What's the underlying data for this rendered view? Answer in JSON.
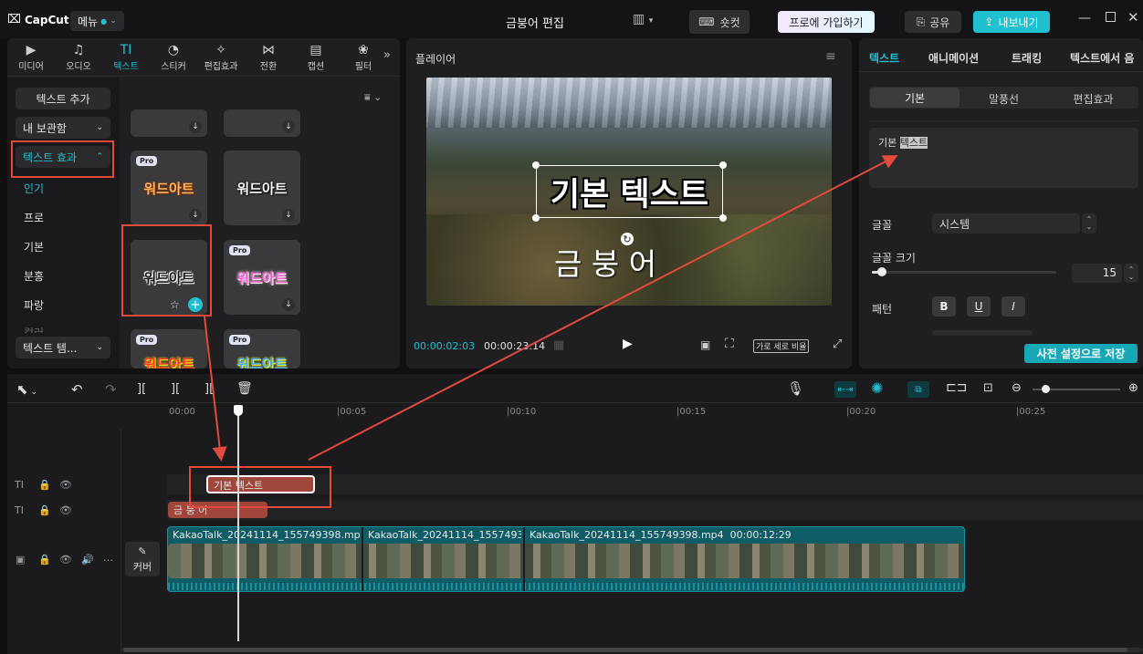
{
  "titlebar": {
    "logo": "CapCut",
    "menu": "메뉴",
    "project_title": "금붕어 편집",
    "shortcut": "숏컷",
    "pro_signup": "프로에 가입하기",
    "share": "공유",
    "export": "내보내기"
  },
  "media_tabs": [
    {
      "label": "미디어",
      "icon": "media-icon"
    },
    {
      "label": "오디오",
      "icon": "audio-icon"
    },
    {
      "label": "텍스트",
      "icon": "text-icon"
    },
    {
      "label": "스티커",
      "icon": "sticker-icon"
    },
    {
      "label": "편집효과",
      "icon": "effects-icon"
    },
    {
      "label": "전환",
      "icon": "transition-icon"
    },
    {
      "label": "캡션",
      "icon": "caption-icon"
    },
    {
      "label": "필터",
      "icon": "filter-icon"
    }
  ],
  "text_sidebar": {
    "add_text": "텍스트 추가",
    "my_collection": "내 보관함",
    "text_effects": "텍스트 효과",
    "items": [
      "인기",
      "프로",
      "기본",
      "분홍",
      "파랑",
      "컬러"
    ],
    "text_templates": "텍스트 템..."
  },
  "wordart": {
    "label": "워드아트",
    "pro_badge": "Pro"
  },
  "player": {
    "header": "플레이어",
    "current_time": "00:00:02:03",
    "total_time": "00:00:23:14",
    "ratio_label": "가로 세로 비율",
    "overlay_text_main": "기본 텍스트",
    "overlay_text_sub": "금 붕 어"
  },
  "inspector": {
    "tabs": [
      "텍스트",
      "애니메이션",
      "트래킹",
      "텍스트에서 음"
    ],
    "subtabs": [
      "기본",
      "말풍선",
      "편집효과"
    ],
    "text_value_plain": "기본 ",
    "text_value_selected": "텍스트",
    "font_label": "글꼴",
    "font_value": "시스템",
    "size_label": "글꼴 크기",
    "size_value": "15",
    "size_fraction": 0.05,
    "pattern_label": "패턴",
    "bold": "B",
    "underline": "U",
    "italic": "I",
    "save_preset": "사전 설정으로 저장"
  },
  "timeline": {
    "ruler": [
      "00:00",
      "|00:05",
      "|00:10",
      "|00:15",
      "|00:20",
      "|00:25"
    ],
    "text_clip_1": "기본 텍스트",
    "text_clip_2": "금 붕 어",
    "cover_label": "커버",
    "video_clips": [
      {
        "name": "KakaoTalk_20241114_155749398.mp4",
        "extra": "00"
      },
      {
        "name": "KakaoTalk_20241114_155749398.r",
        "extra": ""
      },
      {
        "name": "KakaoTalk_20241114_155749398.mp4",
        "extra": "00:00:12:29"
      }
    ]
  },
  "colors": {
    "accent": "#1fc1d0",
    "annotation": "#e24a3b",
    "text_clip": "#a1463b",
    "video_clip": "#0e5c66"
  }
}
